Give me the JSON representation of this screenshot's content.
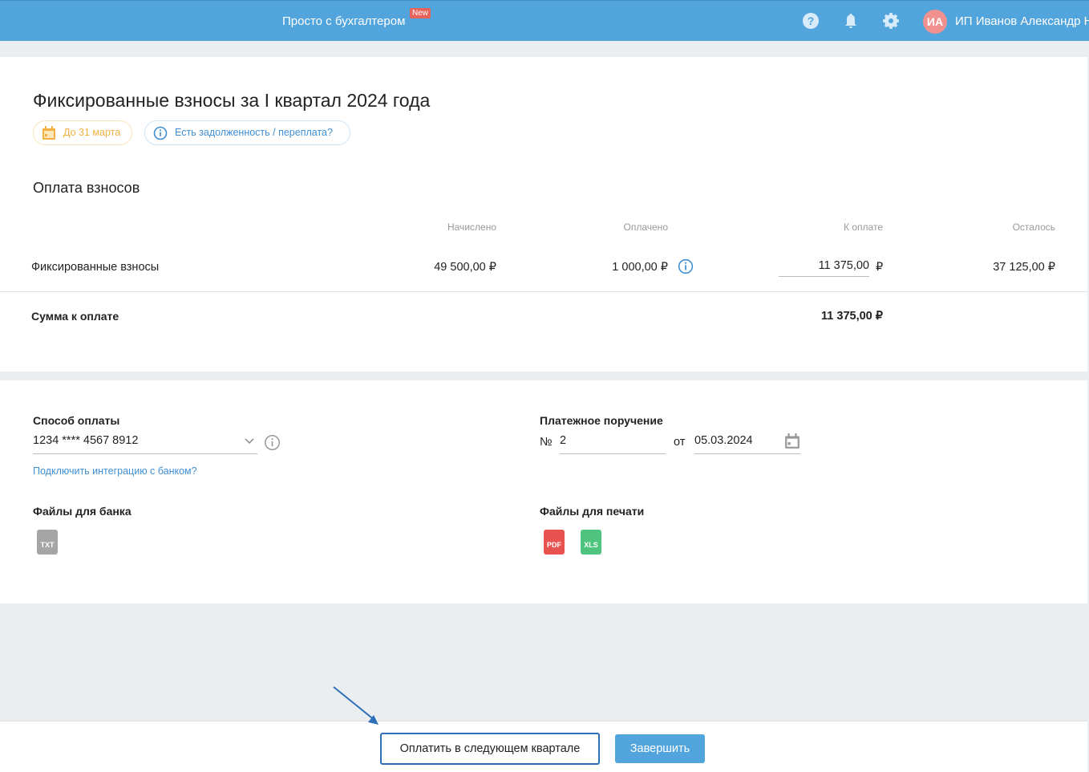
{
  "header": {
    "brand": "Просто с бухгалтером",
    "badge": "New",
    "avatar_initials": "ИА",
    "user_name": "ИП Иванов Александр Н"
  },
  "page": {
    "title": "Фиксированные взносы за I квартал 2024 года",
    "deadline": "До 31 марта",
    "debt_link": "Есть задолженность / переплата?"
  },
  "payments": {
    "title": "Оплата взносов",
    "columns": [
      "Начислено",
      "Оплачено",
      "К оплате",
      "Осталось"
    ],
    "row": {
      "label": "Фиксированные взносы",
      "accrued": "49 500,00 ₽",
      "paid": "1 000,00 ₽",
      "to_pay": "11 375,00",
      "currency": "₽",
      "remaining": "37 125,00 ₽"
    },
    "total_label": "Сумма к оплате",
    "total": "11 375,00 ₽"
  },
  "payment_method": {
    "label": "Способ оплаты",
    "value": "1234 **** 4567 8912",
    "bank_link": "Подключить интеграцию с банком?"
  },
  "order": {
    "label": "Платежное поручение",
    "number_prefix": "№",
    "number": "2",
    "date_prefix": "от",
    "date": "05.03.2024"
  },
  "bank_files": {
    "label": "Файлы для банка",
    "files": [
      "TXT"
    ]
  },
  "print_files": {
    "label": "Файлы для печати",
    "files": [
      "PDF",
      "XLS"
    ]
  },
  "footer": {
    "next_quarter": "Оплатить в следующем квартале",
    "finish": "Завершить"
  },
  "colors": {
    "header": "#52a5dc",
    "accent": "#3f8fd2",
    "warning": "#f2b040"
  }
}
